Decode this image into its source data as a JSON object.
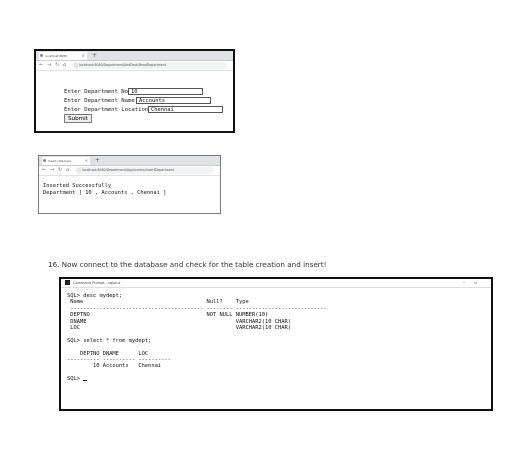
{
  "browser1": {
    "tab_title": "localhost:8080",
    "url": "localhost:8080/Department/AddDept/ReadDepartment",
    "fields": [
      {
        "label": "Enter Department No:",
        "value": "10"
      },
      {
        "label": "Enter Department Name :",
        "value": "Accounts"
      },
      {
        "label": "Enter Department Location :",
        "value": "Chennai"
      }
    ],
    "submit_label": "Submit"
  },
  "browser2": {
    "tab_title": "Insert title here",
    "url": "localhost:8080/Department/Application/InsertDepartment",
    "line1": "Inserted Successfully",
    "line2": "Department [ 10 , Accounts , Chennai ]"
  },
  "caption": "16. Now connect to the database and check for the table creation and insert!",
  "cmd": {
    "title": "Command Prompt - sqlplus",
    "lines": [
      "SQL> desc mydept;",
      " Name                                      Null?    Type",
      " ----------------------------------------- -------- ----------------------------",
      " DEPTNO                                    NOT NULL NUMBER(10)",
      " DNAME                                              VARCHAR2(10 CHAR)",
      " LOC                                                VARCHAR2(10 CHAR)",
      "",
      "SQL> select * from mydept;",
      "",
      "    DEPTNO DNAME      LOC",
      "---------- ---------- ----------",
      "        10 Accounts   Chennai",
      "",
      "SQL> "
    ]
  }
}
